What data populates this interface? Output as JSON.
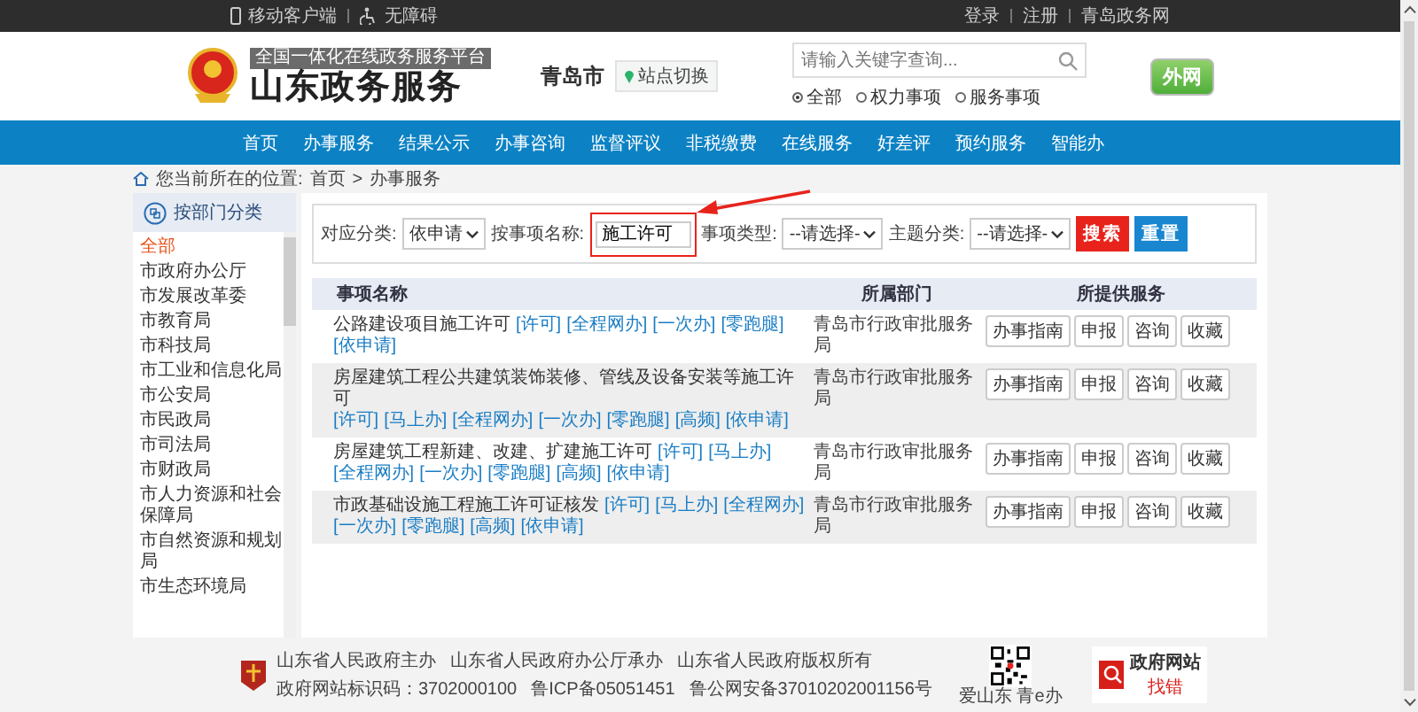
{
  "top_bar": {
    "left": [
      "移动客户端",
      "无障碍"
    ],
    "right": [
      "登录",
      "注册",
      "青岛政务网"
    ]
  },
  "header": {
    "platform_tag": "全国一体化在线政务服务平台",
    "site_name": "山东政务服务",
    "city": "青岛市",
    "switch_button": "站点切换",
    "search": {
      "placeholder": "请输入关键字查询..."
    },
    "scopes": [
      {
        "label": "全部",
        "selected": true
      },
      {
        "label": "权力事项",
        "selected": false
      },
      {
        "label": "服务事项",
        "selected": false
      }
    ],
    "network_button": "外网"
  },
  "nav": [
    "首页",
    "办事服务",
    "结果公示",
    "办事咨询",
    "监督评议",
    "非税缴费",
    "在线服务",
    "好差评",
    "预约服务",
    "智能办"
  ],
  "breadcrumb": {
    "label": "您当前所在的位置:",
    "path": [
      "首页",
      "办事服务"
    ],
    "separator": ">"
  },
  "sidebar": {
    "title": "按部门分类",
    "items": [
      {
        "label": "全部",
        "selected": true
      },
      {
        "label": "市政府办公厅",
        "selected": false
      },
      {
        "label": "市发展改革委",
        "selected": false
      },
      {
        "label": "市教育局",
        "selected": false
      },
      {
        "label": "市科技局",
        "selected": false
      },
      {
        "label": "市工业和信息化局",
        "selected": false
      },
      {
        "label": "市公安局",
        "selected": false
      },
      {
        "label": "市民政局",
        "selected": false
      },
      {
        "label": "市司法局",
        "selected": false
      },
      {
        "label": "市财政局",
        "selected": false
      },
      {
        "label": "市人力资源和社会保障局",
        "selected": false
      },
      {
        "label": "市自然资源和规划局",
        "selected": false
      },
      {
        "label": "市生态环境局",
        "selected": false
      }
    ]
  },
  "filters": [
    {
      "kind": "select",
      "label": "对应分类:",
      "value": "依申请"
    },
    {
      "kind": "input",
      "label": "按事项名称:",
      "value": "施工许可"
    },
    {
      "kind": "select",
      "label": "事项类型:",
      "value": "--请选择-"
    },
    {
      "kind": "select",
      "label": "主题分类:",
      "value": "--请选择-"
    }
  ],
  "filter_buttons": [
    {
      "kind": "primary",
      "label": "搜索"
    },
    {
      "kind": "secondary",
      "label": "重置"
    }
  ],
  "table": {
    "columns": [
      "事项名称",
      "所属部门",
      "所提供服务"
    ],
    "rows": [
      {
        "name": "公路建设项目施工许可",
        "tags": [
          "[许可]",
          "[全程网办]",
          "[一次办]",
          "[零跑腿]",
          "[依申请]"
        ],
        "department": "青岛市行政审批服务局",
        "services": [
          "办事指南",
          "申报",
          "咨询",
          "收藏"
        ]
      },
      {
        "name": "房屋建筑工程公共建筑装饰装修、管线及设备安装等施工许可",
        "tags": [
          "[许可]",
          "[马上办]",
          "[全程网办]",
          "[一次办]",
          "[零跑腿]",
          "[高频]",
          "[依申请]"
        ],
        "department": "青岛市行政审批服务局",
        "services": [
          "办事指南",
          "申报",
          "咨询",
          "收藏"
        ]
      },
      {
        "name": "房屋建筑工程新建、改建、扩建施工许可",
        "tags": [
          "[许可]",
          "[马上办]",
          "[全程网办]",
          "[一次办]",
          "[零跑腿]",
          "[高频]",
          "[依申请]"
        ],
        "department": "青岛市行政审批服务局",
        "services": [
          "办事指南",
          "申报",
          "咨询",
          "收藏"
        ]
      },
      {
        "name": "市政基础设施工程施工许可证核发",
        "tags": [
          "[许可]",
          "[马上办]",
          "[全程网办]",
          "[一次办]",
          "[零跑腿]",
          "[高频]",
          "[依申请]"
        ],
        "department": "青岛市行政审批服务局",
        "services": [
          "办事指南",
          "申报",
          "咨询",
          "收藏"
        ]
      }
    ]
  },
  "footer": {
    "lines": [
      [
        "山东省人民政府主办",
        "山东省人民政府办公厅承办",
        "山东省人民政府版权所有"
      ],
      [
        "政府网站标识码：3702000100",
        "鲁ICP备05051451",
        "鲁公网安备37010202001156号"
      ]
    ],
    "qr_caption": "爱山东 青e办",
    "badge": {
      "title": "政府网站",
      "action": "找错"
    }
  }
}
